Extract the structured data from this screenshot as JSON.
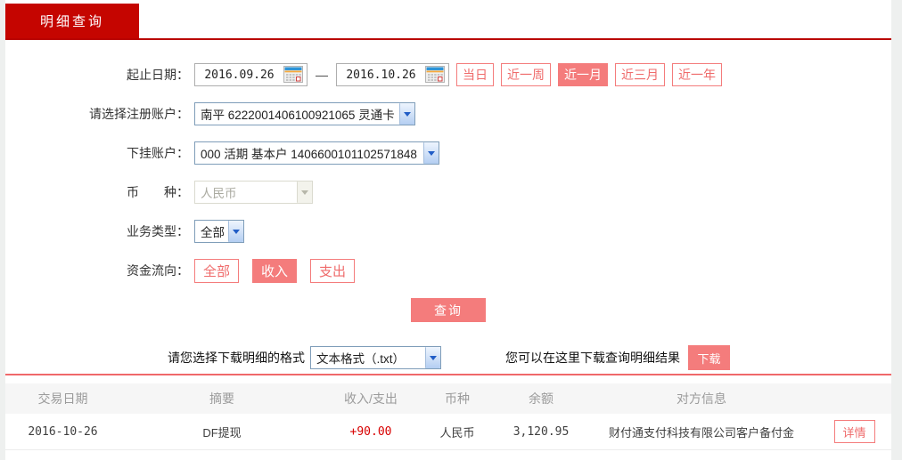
{
  "tab": {
    "title": "明细查询"
  },
  "form": {
    "date_range": {
      "label": "起止日期：",
      "start": "2016.09.26",
      "separator": "—",
      "end": "2016.10.26",
      "quick_buttons": [
        {
          "label": "当日",
          "active": false
        },
        {
          "label": "近一周",
          "active": false
        },
        {
          "label": "近一月",
          "active": true
        },
        {
          "label": "近三月",
          "active": false
        },
        {
          "label": "近一年",
          "active": false
        }
      ]
    },
    "registered_account": {
      "label": "请选择注册账户：",
      "value": "南平 6222001406100921065 灵通卡"
    },
    "sub_account": {
      "label": "下挂账户：",
      "value": "000 活期 基本户 1406600101102571848"
    },
    "currency": {
      "label": "币　　种：",
      "value": "人民币",
      "disabled": true
    },
    "business_type": {
      "label": "业务类型：",
      "value": "全部"
    },
    "fund_flow": {
      "label": "资金流向：",
      "options": [
        {
          "label": "全部",
          "active": false
        },
        {
          "label": "收入",
          "active": true
        },
        {
          "label": "支出",
          "active": false
        }
      ]
    },
    "query_button": "查询"
  },
  "download": {
    "format_label": "请您选择下载明细的格式",
    "format_value": "文本格式（.txt）",
    "hint": "您可以在这里下载查询明细结果",
    "button": "下载"
  },
  "table": {
    "headers": [
      "交易日期",
      "摘要",
      "收入/支出",
      "币种",
      "余额",
      "对方信息"
    ],
    "rows": [
      {
        "date": "2016-10-26",
        "summary": "DF提现",
        "amount": "+90.00",
        "currency": "人民币",
        "balance": "3,120.95",
        "counterparty": "财付通支付科技有限公司客户备付金",
        "action": "详情"
      }
    ]
  },
  "colors": {
    "tab_red": "#c50500",
    "underline_red": "#b90300",
    "accent_salmon": "#f47c7c",
    "divider_salmon": "#f0686a",
    "amount_red": "#d80000",
    "header_text_gray": "#9b9b9b"
  }
}
